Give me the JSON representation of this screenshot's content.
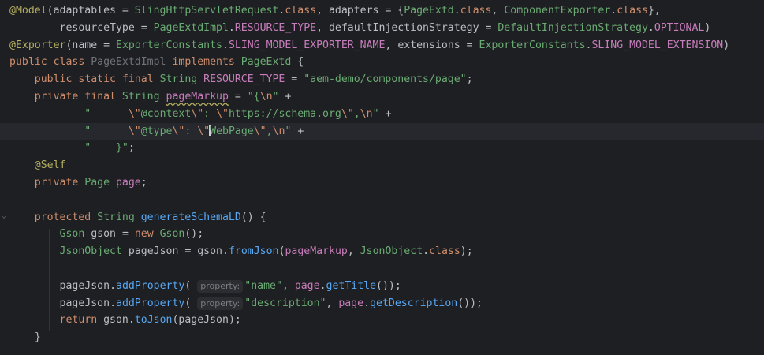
{
  "editor": {
    "hint_label": "property:",
    "lines": {
      "l1": [
        "@Model",
        "(adaptables = ",
        "SlingHttpServletRequest",
        ".",
        "class",
        ", adapters = {",
        "PageExtd",
        ".",
        "class",
        ", ",
        "ComponentExporter",
        ".",
        "class",
        "},"
      ],
      "l2": [
        "        resourceType = ",
        "PageExtdImpl",
        ".",
        "RESOURCE_TYPE",
        ", defaultInjectionStrategy = ",
        "DefaultInjectionStrategy",
        ".",
        "OPTIONAL",
        ")"
      ],
      "l3": [
        "@Exporter",
        "(name = ",
        "ExporterConstants",
        ".",
        "SLING_MODEL_EXPORTER_NAME",
        ", extensions = ",
        "ExporterConstants",
        ".",
        "SLING_MODEL_EXTENSION",
        ")"
      ],
      "l4": [
        "public class ",
        "PageExtdImpl",
        " implements ",
        "PageExtd",
        " {"
      ],
      "l5": [
        "    public static final ",
        "String ",
        "RESOURCE_TYPE",
        " = ",
        "\"aem-demo/components/page\"",
        ";"
      ],
      "l6": [
        "    private final ",
        "String ",
        "pageMarkup",
        " = ",
        "\"{",
        "\\n",
        "\"",
        " +"
      ],
      "l7": [
        "            \"      ",
        "\\\"",
        "@context",
        "\\\"",
        ": ",
        "\\\"",
        "https://schema.org",
        "\\\"",
        ",",
        "\\n",
        "\"",
        " +"
      ],
      "l8": [
        "            \"      ",
        "\\\"",
        "@type",
        "\\\"",
        ": ",
        "\\\"",
        "W",
        "ebPage",
        "\\\"",
        ",",
        "\\n",
        "\"",
        " +"
      ],
      "l9": [
        "            \"    }\"",
        ";"
      ],
      "l10": [
        "    @Self"
      ],
      "l11": [
        "    private ",
        "Page ",
        "page",
        ";"
      ],
      "l12": [
        ""
      ],
      "l13": [
        "    protected ",
        "String ",
        "generateSchemaLD",
        "() {"
      ],
      "l14": [
        "        ",
        "Gson ",
        "gson",
        " = ",
        "new ",
        "Gson",
        "();"
      ],
      "l15": [
        "        ",
        "JsonObject ",
        "pageJson",
        " = ",
        "gson",
        ".",
        "fromJson",
        "(",
        "pageMarkup",
        ", ",
        "JsonObject",
        ".",
        "class",
        ");"
      ],
      "l16": [
        ""
      ],
      "l17": [
        "        ",
        "pageJson",
        ".",
        "addProperty",
        "( ",
        "\"name\"",
        ", ",
        "page",
        ".",
        "getTitle",
        "());"
      ],
      "l18": [
        "        ",
        "pageJson",
        ".",
        "addProperty",
        "( ",
        "\"description\"",
        ", ",
        "page",
        ".",
        "getDescription",
        "());"
      ],
      "l19": [
        "        ",
        "return ",
        "gson",
        ".",
        "toJson",
        "(",
        "pageJson",
        ");"
      ],
      "l20": [
        "    }"
      ]
    }
  },
  "colors": {
    "background": "#1e1f22",
    "keyword": "#cf8e6d",
    "annotation": "#b3ae60",
    "string": "#6aab73",
    "method": "#56a8f5",
    "constant": "#c77dbb"
  },
  "icons": {
    "bulb": "lightbulb-icon",
    "fold": "fold-arrow-icon"
  }
}
